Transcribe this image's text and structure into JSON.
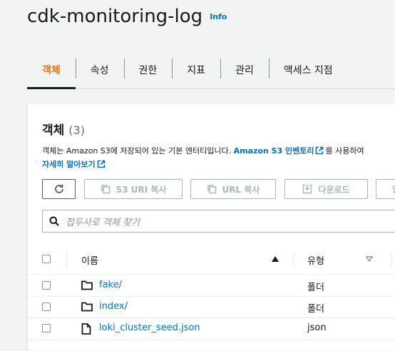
{
  "header": {
    "title": "cdk-monitoring-log",
    "info": "Info"
  },
  "tabs": [
    {
      "label": "객체",
      "active": true
    },
    {
      "label": "속성"
    },
    {
      "label": "권한"
    },
    {
      "label": "지표"
    },
    {
      "label": "관리"
    },
    {
      "label": "액세스 지점"
    }
  ],
  "panel": {
    "title": "객체",
    "count": "(3)",
    "desc_text": "객체는 Amazon S3에 저장되어 있는 기본 엔터티입니다. ",
    "inventory_link": "Amazon S3 인벤토리",
    "desc_after": "를 사용하여",
    "learn_more": "자세히 알아보기"
  },
  "toolbar": {
    "copy_s3_uri": "S3 URI 복사",
    "copy_url": "URL 복사",
    "download": "다운로드",
    "open_partial": "열"
  },
  "search": {
    "placeholder": "접두사로 객체 찾기"
  },
  "table": {
    "col_name": "이름",
    "col_type": "유형",
    "rows": [
      {
        "name": "fake/",
        "type": "폴더",
        "icon": "folder-icon"
      },
      {
        "name": "index/",
        "type": "폴더",
        "icon": "folder-icon"
      },
      {
        "name": "loki_cluster_seed.json",
        "type": "json",
        "icon": "file-icon"
      }
    ]
  },
  "colors": {
    "accent": "#ec7211",
    "link": "#0073bb"
  }
}
